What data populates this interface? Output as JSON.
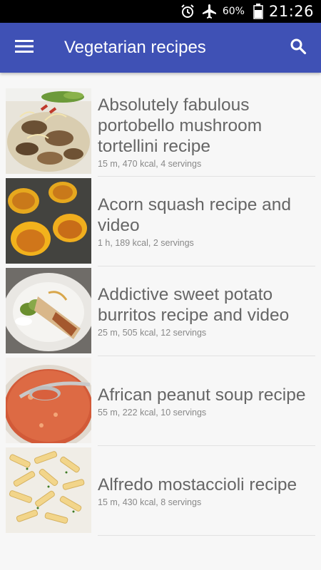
{
  "status_bar": {
    "icons": [
      "alarm-icon",
      "airplane-mode-icon",
      "battery-icon"
    ],
    "battery": "60%",
    "time": "21:26"
  },
  "app_bar": {
    "title": "Vegetarian recipes",
    "left_icon": "hamburger-menu-icon",
    "right_icon": "search-icon",
    "color": "#3f51b5"
  },
  "recipes": [
    {
      "title": "Absolutely fabulous portobello mushroom tortellini recipe",
      "meta": "15 m, 470 kcal, 4 servings",
      "image": "mushroom-tortellini-photo"
    },
    {
      "title": "Acorn squash recipe and video",
      "meta": "1 h, 189 kcal, 2 servings",
      "image": "acorn-squash-photo"
    },
    {
      "title": "Addictive sweet potato burritos recipe and video",
      "meta": "25 m, 505 kcal, 12 servings",
      "image": "sweet-potato-burrito-photo"
    },
    {
      "title": "African peanut soup recipe",
      "meta": "55 m, 222 kcal, 10 servings",
      "image": "peanut-soup-photo"
    },
    {
      "title": "Alfredo mostaccioli recipe",
      "meta": "15 m, 430 kcal, 8 servings",
      "image": "mostaccioli-pasta-photo"
    }
  ]
}
